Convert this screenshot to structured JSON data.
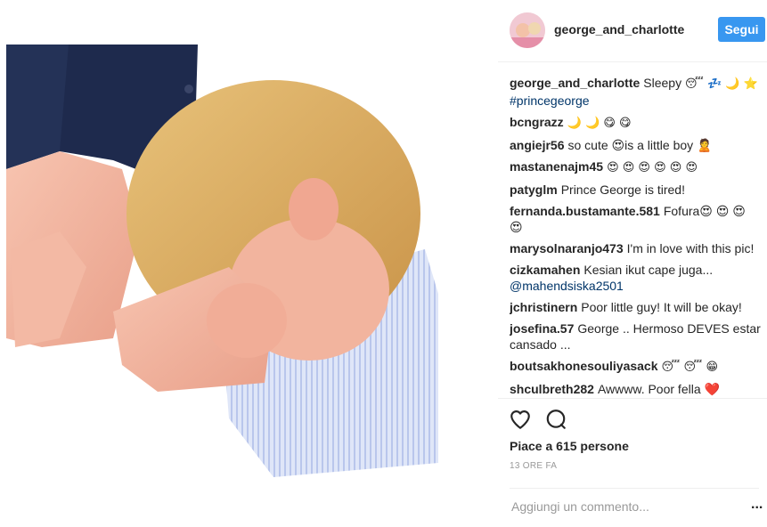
{
  "post": {
    "username": "george_and_charlotte",
    "follow_label": "Segui"
  },
  "comments": [
    {
      "user": "george_and_charlotte",
      "text": "Sleepy",
      "emoji": "😴 💤 🌙 ⭐",
      "hashtag": "#princegeorge"
    },
    {
      "user": "bcngrazz",
      "text": "",
      "emoji": "🌙 🌙 😋 😋"
    },
    {
      "user": "angiejr56",
      "text": "so cute 😍is a little boy 🙎"
    },
    {
      "user": "mastanenajm45",
      "text": "",
      "emoji": "😍 😍 😍 😍 😍 😍"
    },
    {
      "user": "patyglm",
      "text": "Prince George is tired!"
    },
    {
      "user": "fernanda.bustamante.581",
      "text": "Fofura😍 😍 😍 😍"
    },
    {
      "user": "marysolnaranjo473",
      "text": "I'm in love with this pic!"
    },
    {
      "user": "cizkamahen",
      "text": "Kesian ikut cape juga...",
      "mention": "@mahendsiska2501"
    },
    {
      "user": "jchristinern",
      "text": "Poor little guy! It will be okay!"
    },
    {
      "user": "josefina.57",
      "text": "George .. Hermoso DEVES estar cansado ..."
    },
    {
      "user": "boutsakhonesouliyasack",
      "text": "",
      "emoji": "😴 😴 😁"
    },
    {
      "user": "shculbreth282",
      "text": "Awwww. Poor fella ❤️"
    }
  ],
  "actions": {
    "like_icon": "heart-icon",
    "comment_icon": "comment-bubble-icon",
    "likes_text": "Piace a 615 persone",
    "timestamp": "13 ORE FA"
  },
  "add_comment": {
    "placeholder": "Aggiungi un commento...",
    "more_label": "..."
  },
  "colors": {
    "accent": "#3897f0",
    "hashtag": "#003569",
    "text": "#262626",
    "muted": "#999999"
  }
}
